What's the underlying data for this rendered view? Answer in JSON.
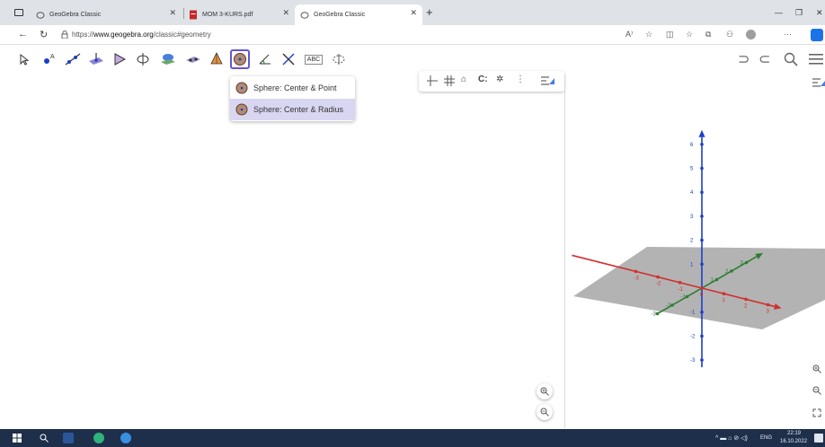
{
  "browser": {
    "tabs": [
      {
        "title": "GeoGebra Classic",
        "icon": "geogebra-icon",
        "active": false
      },
      {
        "title": "MOM 3-KURS.pdf",
        "icon": "pdf-icon",
        "active": false
      },
      {
        "title": "GeoGebra Classic",
        "icon": "geogebra-icon",
        "active": true
      }
    ],
    "new_tab": "+",
    "url_prefix": "https://",
    "url_host": "www.geogebra.org",
    "url_path": "/classic#geometry",
    "more": "···"
  },
  "toolbar": {
    "tools": [
      "move-tool-icon",
      "point-tool-icon",
      "line-tool-icon",
      "perpendicular-tool-icon",
      "polygon-tool-icon",
      "circle-axis-tool-icon",
      "intersect-surfaces-tool-icon",
      "plane-tool-icon",
      "pyramid-tool-icon",
      "sphere-tool-icon",
      "angle-tool-icon",
      "reflect-tool-icon",
      "text-tool-icon",
      "rotate-view-tool-icon"
    ],
    "selected_tool": "sphere-tool-icon",
    "text_tool_label": "ABC"
  },
  "dropdown": {
    "items": [
      {
        "label": "Sphere: Center & Point",
        "selected": false
      },
      {
        "label": "Sphere: Center & Radius",
        "selected": true
      }
    ]
  },
  "chart_data": {
    "type": "3d-axes",
    "z_ticks": [
      "6",
      "5",
      "4",
      "3",
      "2",
      "1",
      "-1",
      "-2",
      "-3"
    ],
    "x_ticks": [
      "-3",
      "-2",
      "-1",
      "0",
      "1",
      "2",
      "3"
    ],
    "y_ticks": [
      "-3",
      "-2",
      "-1",
      "1",
      "2",
      "3"
    ],
    "colors": {
      "x": "#d32f2f",
      "y": "#2e7d32",
      "z": "#1a3fc9",
      "plane": "#a6a6a6"
    }
  },
  "taskbar": {
    "lang": "ENG",
    "time": "22:19",
    "date": "16.10.2022"
  }
}
